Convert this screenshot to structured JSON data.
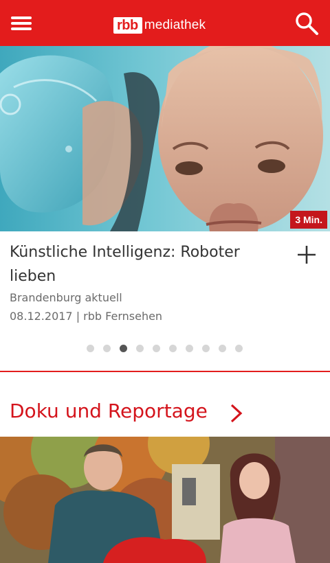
{
  "app": {
    "logo_box": "rbb",
    "logo_text": "mediathek"
  },
  "header": {
    "menu_icon": "hamburger-menu-icon",
    "search_icon": "search-icon"
  },
  "carousel": {
    "duration": "3 Min.",
    "title": "Künstliche Intelligenz: Roboter lieben",
    "show": "Brandenburg aktuell",
    "meta": "08.12.2017 | rbb Fernsehen",
    "add_icon": "plus-icon",
    "page_count": 10,
    "active_index": 2
  },
  "section": {
    "title": "Doku und Reportage",
    "arrow_icon": "chevron-right-icon"
  },
  "colors": {
    "brand_red": "#e31c1c",
    "section_red": "#d4141c",
    "badge_red": "#c4161c"
  }
}
